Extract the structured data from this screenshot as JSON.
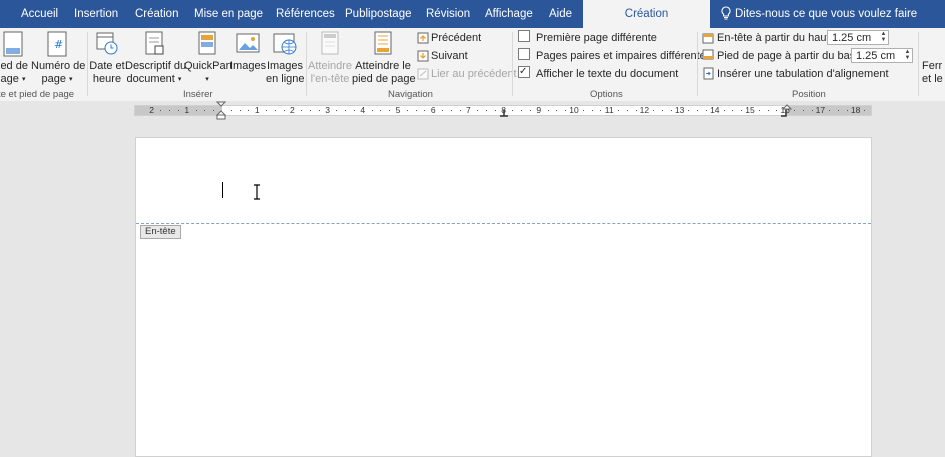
{
  "tabs": [
    {
      "label": "Accueil",
      "active": false
    },
    {
      "label": "Insertion",
      "active": false
    },
    {
      "label": "Création",
      "active": false
    },
    {
      "label": "Mise en page",
      "active": false
    },
    {
      "label": "Références",
      "active": false
    },
    {
      "label": "Publipostage",
      "active": false
    },
    {
      "label": "Révision",
      "active": false
    },
    {
      "label": "Affichage",
      "active": false
    },
    {
      "label": "Aide",
      "active": false
    },
    {
      "label": "Création",
      "active": true
    }
  ],
  "tell_me": "Dites-nous ce que vous voulez faire",
  "ribbon": {
    "header_footer_group": {
      "label": "te et pied de page",
      "footer_btn": {
        "line1": "ied de",
        "line2": "age"
      },
      "page_number_btn": {
        "line1": "Numéro de",
        "line2": "page"
      }
    },
    "insert_group": {
      "label": "Insérer",
      "date_time": {
        "line1": "Date et",
        "line2": "heure"
      },
      "doc_info": {
        "line1": "Descriptif du",
        "line2": "document"
      },
      "quickpart": {
        "line1": "QuickPart"
      },
      "images": {
        "line1": "Images"
      },
      "online_images": {
        "line1": "Images",
        "line2": "en ligne"
      }
    },
    "navigation_group": {
      "label": "Navigation",
      "goto_header": {
        "line1": "Atteindre",
        "line2": "l'en-tête"
      },
      "goto_footer": {
        "line1": "Atteindre le",
        "line2": "pied de page"
      },
      "previous": "Précédent",
      "next": "Suivant",
      "link_previous": "Lier au précédent"
    },
    "options_group": {
      "label": "Options",
      "first_page": {
        "label": "Première page différente",
        "checked": false
      },
      "odd_even": {
        "label": "Pages paires et impaires différentes",
        "checked": false
      },
      "show_text": {
        "label": "Afficher le texte du document",
        "checked": true
      }
    },
    "position_group": {
      "label": "Position",
      "header_top": {
        "label": "En-tête à partir du haut :",
        "value": "1.25 cm"
      },
      "footer_bottom": {
        "label": "Pied de page à partir du bas :",
        "value": "1.25 cm"
      },
      "align_tab": "Insérer une tabulation d'alignement"
    },
    "close_group": {
      "line1": "Ferr",
      "line2": "et le p"
    }
  },
  "ruler": {
    "numbers_left": [
      "2",
      "1"
    ],
    "numbers_right": [
      "1",
      "2",
      "3",
      "4",
      "5",
      "6",
      "7",
      "8",
      "9",
      "10",
      "11",
      "12",
      "13",
      "14",
      "15",
      "16",
      "17",
      "18"
    ]
  },
  "page": {
    "header_tag": "En-tête"
  }
}
